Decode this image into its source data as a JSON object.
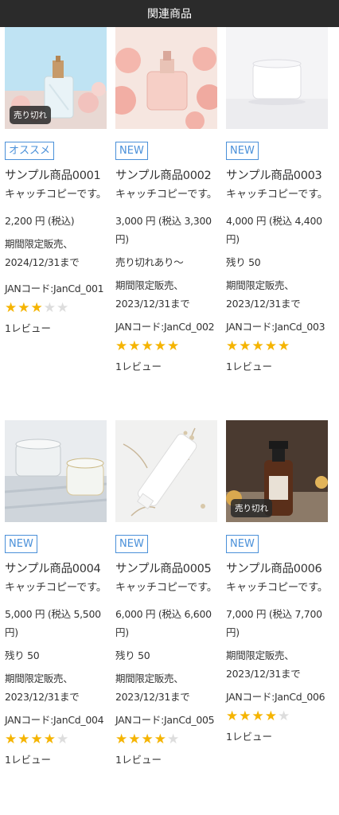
{
  "header": {
    "title": "関連商品"
  },
  "sold_out_label": "売り切れ",
  "colors": {
    "accent": "#4a90d9",
    "star_on": "#f5b400",
    "star_off": "#dddddd",
    "header_bg": "#2b2b2b"
  },
  "products": [
    {
      "badge": "オススメ",
      "title": "サンプル商品0001",
      "catch": "キャッチコピーです。",
      "price": "2,200 円 (税込)",
      "stock": "",
      "limited": "期間限定販売、2024/12/31まで",
      "jan": "JANコード:JanCd_001",
      "rating": 3,
      "reviews": "1レビュー",
      "sold_out": true
    },
    {
      "badge": "NEW",
      "title": "サンプル商品0002",
      "catch": "キャッチコピーです。",
      "price": "3,000 円 (税込 3,300 円)",
      "stock": "売り切れあり〜",
      "limited": "期間限定販売、2023/12/31まで",
      "jan": "JANコード:JanCd_002",
      "rating": 5,
      "reviews": "1レビュー",
      "sold_out": false
    },
    {
      "badge": "NEW",
      "title": "サンプル商品0003",
      "catch": "キャッチコピーです。",
      "price": "4,000 円 (税込 4,400 円)",
      "stock": "残り 50",
      "limited": "期間限定販売、2023/12/31まで",
      "jan": "JANコード:JanCd_003",
      "rating": 5,
      "reviews": "1レビュー",
      "sold_out": false
    },
    {
      "badge": "NEW",
      "title": "サンプル商品0004",
      "catch": "キャッチコピーです。",
      "price": "5,000 円 (税込 5,500 円)",
      "stock": "残り 50",
      "limited": "期間限定販売、2023/12/31まで",
      "jan": "JANコード:JanCd_004",
      "rating": 4,
      "reviews": "1レビュー",
      "sold_out": false
    },
    {
      "badge": "NEW",
      "title": "サンプル商品0005",
      "catch": "キャッチコピーです。",
      "price": "6,000 円 (税込 6,600 円)",
      "stock": "残り 50",
      "limited": "期間限定販売、2023/12/31まで",
      "jan": "JANコード:JanCd_005",
      "rating": 4,
      "reviews": "1レビュー",
      "sold_out": false
    },
    {
      "badge": "NEW",
      "title": "サンプル商品0006",
      "catch": "キャッチコピーです。",
      "price": "7,000 円 (税込 7,700 円)",
      "stock": "",
      "limited": "期間限定販売、2023/12/31まで",
      "jan": "JANコード:JanCd_006",
      "rating": 4,
      "reviews": "1レビュー",
      "sold_out": true
    }
  ]
}
